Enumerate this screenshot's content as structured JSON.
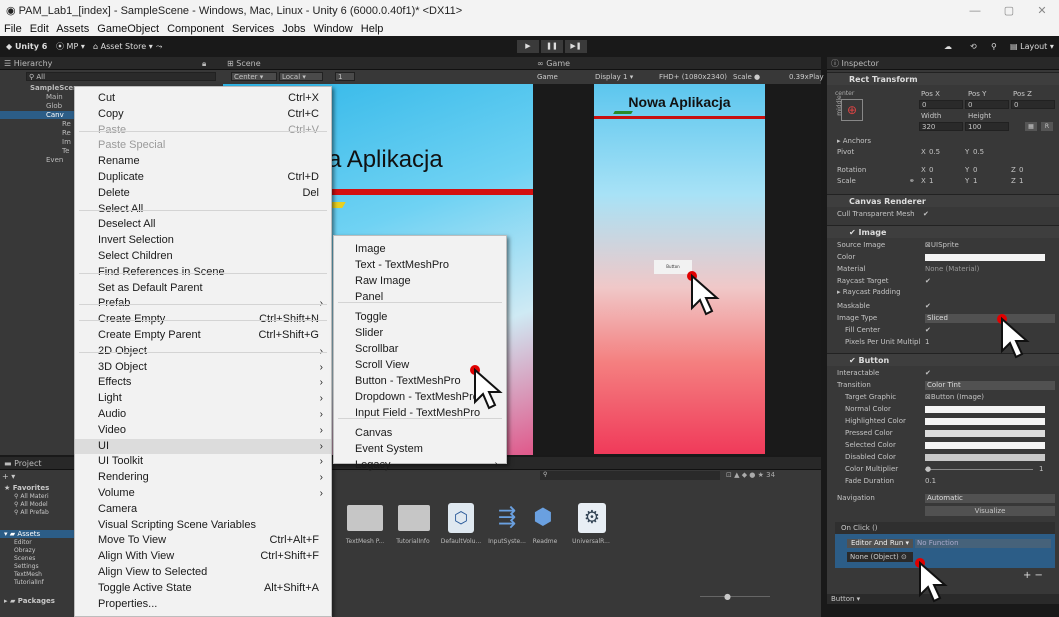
{
  "window": {
    "title": "PAM_Lab1_[index] - SampleScene - Windows, Mac, Linux - Unity 6 (6000.0.40f1)* <DX11>",
    "controls": [
      "—",
      "▢",
      "✕"
    ]
  },
  "menubar": [
    "File",
    "Edit",
    "Assets",
    "GameObject",
    "Component",
    "Services",
    "Jobs",
    "Window",
    "Help"
  ],
  "toolbar": {
    "unity": "Unity 6",
    "mp": "MP ▾",
    "asset_store": "Asset Store ▾",
    "layout": "Layout ▾"
  },
  "hierarchy": {
    "tab": "Hierarchy",
    "search": "All",
    "rows": [
      "SampleScene",
      "Main",
      "Glob",
      "Canv",
      "Re",
      "Re",
      "Im",
      "Te",
      "Even"
    ]
  },
  "scene": {
    "tab": "Scene",
    "center": "Center ▾",
    "local": "Local ▾",
    "num": "1",
    "heading": "a Aplikacja"
  },
  "game": {
    "tab": "Game",
    "mode": "Game",
    "display": "Display 1 ▾",
    "resolution": "FHD+ (1080x2340)",
    "scale_label": "Scale",
    "scale": "0.39x",
    "play": "Play",
    "title": "Nowa Aplikacja",
    "button_label": "Button"
  },
  "context_menu": {
    "items": [
      {
        "label": "Cut",
        "shortcut": "Ctrl+X"
      },
      {
        "label": "Copy",
        "shortcut": "Ctrl+C"
      },
      {
        "label": "Paste",
        "shortcut": "Ctrl+V",
        "disabled": true
      },
      {
        "label": "Paste Special",
        "disabled": true
      },
      {
        "label": "Rename"
      },
      {
        "label": "Duplicate",
        "shortcut": "Ctrl+D"
      },
      {
        "label": "Delete",
        "shortcut": "Del"
      },
      {
        "label": "Select All"
      },
      {
        "label": "Deselect All"
      },
      {
        "label": "Invert Selection"
      },
      {
        "label": "Select Children"
      },
      {
        "label": "Find References in Scene"
      },
      {
        "label": "Set as Default Parent"
      },
      {
        "label": "Prefab",
        "submenu": true
      },
      {
        "label": "Create Empty",
        "shortcut": "Ctrl+Shift+N"
      },
      {
        "label": "Create Empty Parent",
        "shortcut": "Ctrl+Shift+G"
      },
      {
        "label": "2D Object",
        "submenu": true
      },
      {
        "label": "3D Object",
        "submenu": true
      },
      {
        "label": "Effects",
        "submenu": true
      },
      {
        "label": "Light",
        "submenu": true
      },
      {
        "label": "Audio",
        "submenu": true
      },
      {
        "label": "Video",
        "submenu": true
      },
      {
        "label": "UI",
        "submenu": true,
        "highlighted": true
      },
      {
        "label": "UI Toolkit",
        "submenu": true
      },
      {
        "label": "Rendering",
        "submenu": true
      },
      {
        "label": "Volume",
        "submenu": true
      },
      {
        "label": "Camera"
      },
      {
        "label": "Visual Scripting Scene Variables"
      },
      {
        "label": "Move To View",
        "shortcut": "Ctrl+Alt+F"
      },
      {
        "label": "Align With View",
        "shortcut": "Ctrl+Shift+F"
      },
      {
        "label": "Align View to Selected"
      },
      {
        "label": "Toggle Active State",
        "shortcut": "Alt+Shift+A"
      },
      {
        "label": "Properties..."
      }
    ]
  },
  "ui_submenu": {
    "items": [
      {
        "label": "Image"
      },
      {
        "label": "Text - TextMeshPro"
      },
      {
        "label": "Raw Image"
      },
      {
        "label": "Panel"
      },
      {
        "label": "Toggle"
      },
      {
        "label": "Slider"
      },
      {
        "label": "Scrollbar"
      },
      {
        "label": "Scroll View"
      },
      {
        "label": "Button - TextMeshPro"
      },
      {
        "label": "Dropdown - TextMeshPro"
      },
      {
        "label": "Input Field - TextMeshPro"
      },
      {
        "label": "Canvas"
      },
      {
        "label": "Event System"
      },
      {
        "label": "Legacy",
        "submenu": true
      }
    ]
  },
  "inspector": {
    "tab": "Inspector",
    "rect_transform": {
      "title": "Rect Transform",
      "anchor_label": "center",
      "anchor_side": "middle",
      "pos_x_label": "Pos X",
      "pos_y_label": "Pos Y",
      "pos_z_label": "Pos Z",
      "pos_x": "0",
      "pos_y": "0",
      "pos_z": "0",
      "width_label": "Width",
      "height_label": "Height",
      "width": "320",
      "height": "100",
      "r_label": "R",
      "anchors": "Anchors",
      "pivot": "Pivot",
      "pivot_x": "0.5",
      "pivot_y": "0.5",
      "rotation": "Rotation",
      "rot_x": "0",
      "rot_y": "0",
      "rot_z": "0",
      "scale": "Scale",
      "scale_x": "1",
      "scale_y": "1",
      "scale_z": "1",
      "x_label": "X",
      "y_label": "Y",
      "z_label": "Z"
    },
    "canvas_renderer": {
      "title": "Canvas Renderer",
      "cull": "Cull Transparent Mesh"
    },
    "image": {
      "title": "Image",
      "source_label": "Source Image",
      "source": "UISprite",
      "color_label": "Color",
      "material_label": "Material",
      "material": "None (Material)",
      "raycast_target": "Raycast Target",
      "raycast_padding": "Raycast Padding",
      "maskable": "Maskable",
      "image_type_label": "Image Type",
      "image_type": "Sliced",
      "fill_center": "Fill Center",
      "ppu_label": "Pixels Per Unit Multipl",
      "ppu": "1"
    },
    "button": {
      "title": "Button",
      "interactable": "Interactable",
      "transition_label": "Transition",
      "transition": "Color Tint",
      "target_graphic_label": "Target Graphic",
      "target_graphic": "Button (Image)",
      "normal": "Normal Color",
      "highlighted": "Highlighted Color",
      "pressed": "Pressed Color",
      "selected": "Selected Color",
      "disabled": "Disabled Color",
      "multiplier_label": "Color Multiplier",
      "multiplier": "1",
      "fade_label": "Fade Duration",
      "fade": "0.1",
      "navigation_label": "Navigation",
      "navigation": "Automatic",
      "visualize": "Visualize",
      "onclick": "On Click ()",
      "runtime": "Editor And Run ▾",
      "function": "No Function",
      "object": "None (Object)"
    },
    "footer": "Button ▾"
  },
  "project": {
    "tab": "Project",
    "favorites": "Favorites",
    "fav_items": [
      "All Materi",
      "All Model",
      "All Prefab"
    ],
    "assets": "Assets",
    "asset_folders": [
      "Editor",
      "Obrazy",
      "Scenes",
      "Settings",
      "TextMesh",
      "TutorialInf"
    ],
    "packages": "Packages",
    "count": "34",
    "tiles": [
      "TextMesh P...",
      "TutorialInfo",
      "DefaultVolu...",
      "InputSyste...",
      "Readme",
      "UniversalR..."
    ]
  },
  "colors": {
    "accent": "#2c5d87",
    "cursor_dot": "#e00000"
  }
}
